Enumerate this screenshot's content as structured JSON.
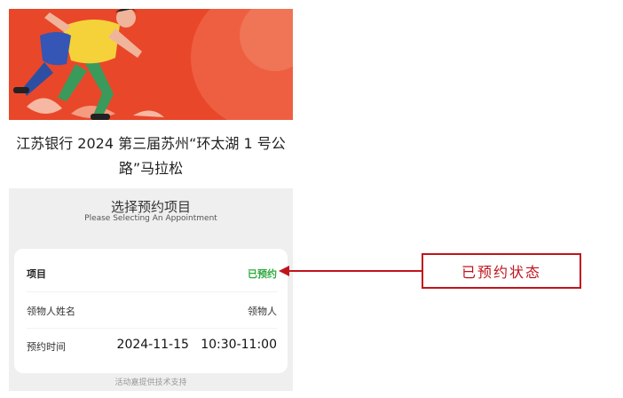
{
  "event": {
    "title": "江苏银行 2024 第三届苏州“环太湖 1 号公路”马拉松"
  },
  "appointment": {
    "section_title": "选择预约项目",
    "section_subtitle": "Please Selecting An Appointment",
    "rows": [
      {
        "label": "项目",
        "value": "已预约"
      },
      {
        "label": "领物人姓名",
        "value": "领物人"
      },
      {
        "label": "预约时间",
        "value": "2024-11-15   10:30-11:00"
      }
    ],
    "status_color": "#2eab3e"
  },
  "footer": {
    "text": "活动嘉提供技术支持"
  },
  "annotation": {
    "label": "已预约状态",
    "color": "#c0141c"
  }
}
